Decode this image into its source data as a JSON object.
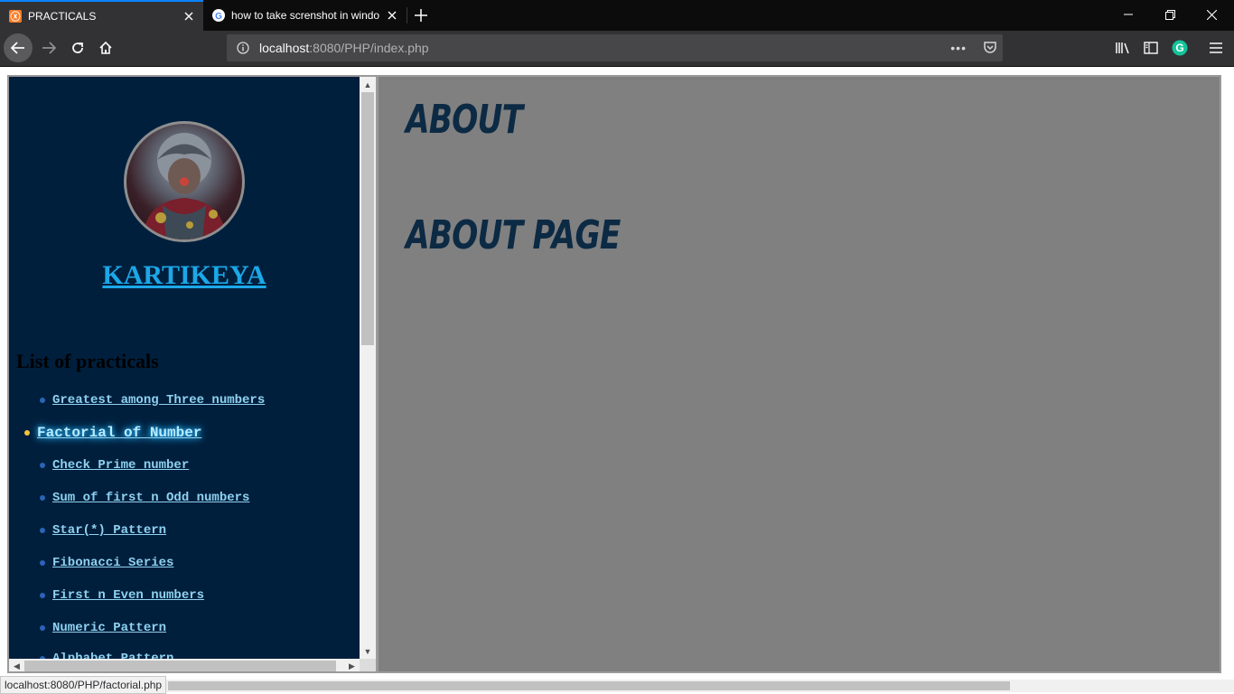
{
  "browser": {
    "tabs": [
      {
        "title": "PRACTICALS",
        "favicon": "xampp-icon",
        "active": true
      },
      {
        "title": "how to take screnshot in windo",
        "favicon": "google-icon",
        "active": false
      }
    ],
    "url": {
      "host": "localhost",
      "rest": ":8080/PHP/index.php"
    },
    "page_actions": "•••",
    "status_text": "localhost:8080/PHP/factorial.php"
  },
  "sidebar": {
    "profile_name": "KARTIKEYA",
    "list_heading": "List of practicals",
    "items": [
      {
        "label": "Greatest among Three numbers"
      },
      {
        "label": "Factorial of Number",
        "active": true
      },
      {
        "label": "Check Prime number"
      },
      {
        "label": "Sum of first n Odd numbers"
      },
      {
        "label": "Star(*) Pattern"
      },
      {
        "label": "Fibonacci Series"
      },
      {
        "label": "First n Even numbers"
      },
      {
        "label": "Numeric Pattern"
      },
      {
        "label": "Alphabet Pattern"
      }
    ]
  },
  "main": {
    "title": "ABOUT",
    "subtitle": "ABOUT PAGE"
  },
  "colors": {
    "sidebar_bg": "#001f3d",
    "main_bg": "#808080",
    "name_link": "#1ba8e8",
    "heading_text": "#0c2a44",
    "active_bullet": "#f2c53d"
  }
}
